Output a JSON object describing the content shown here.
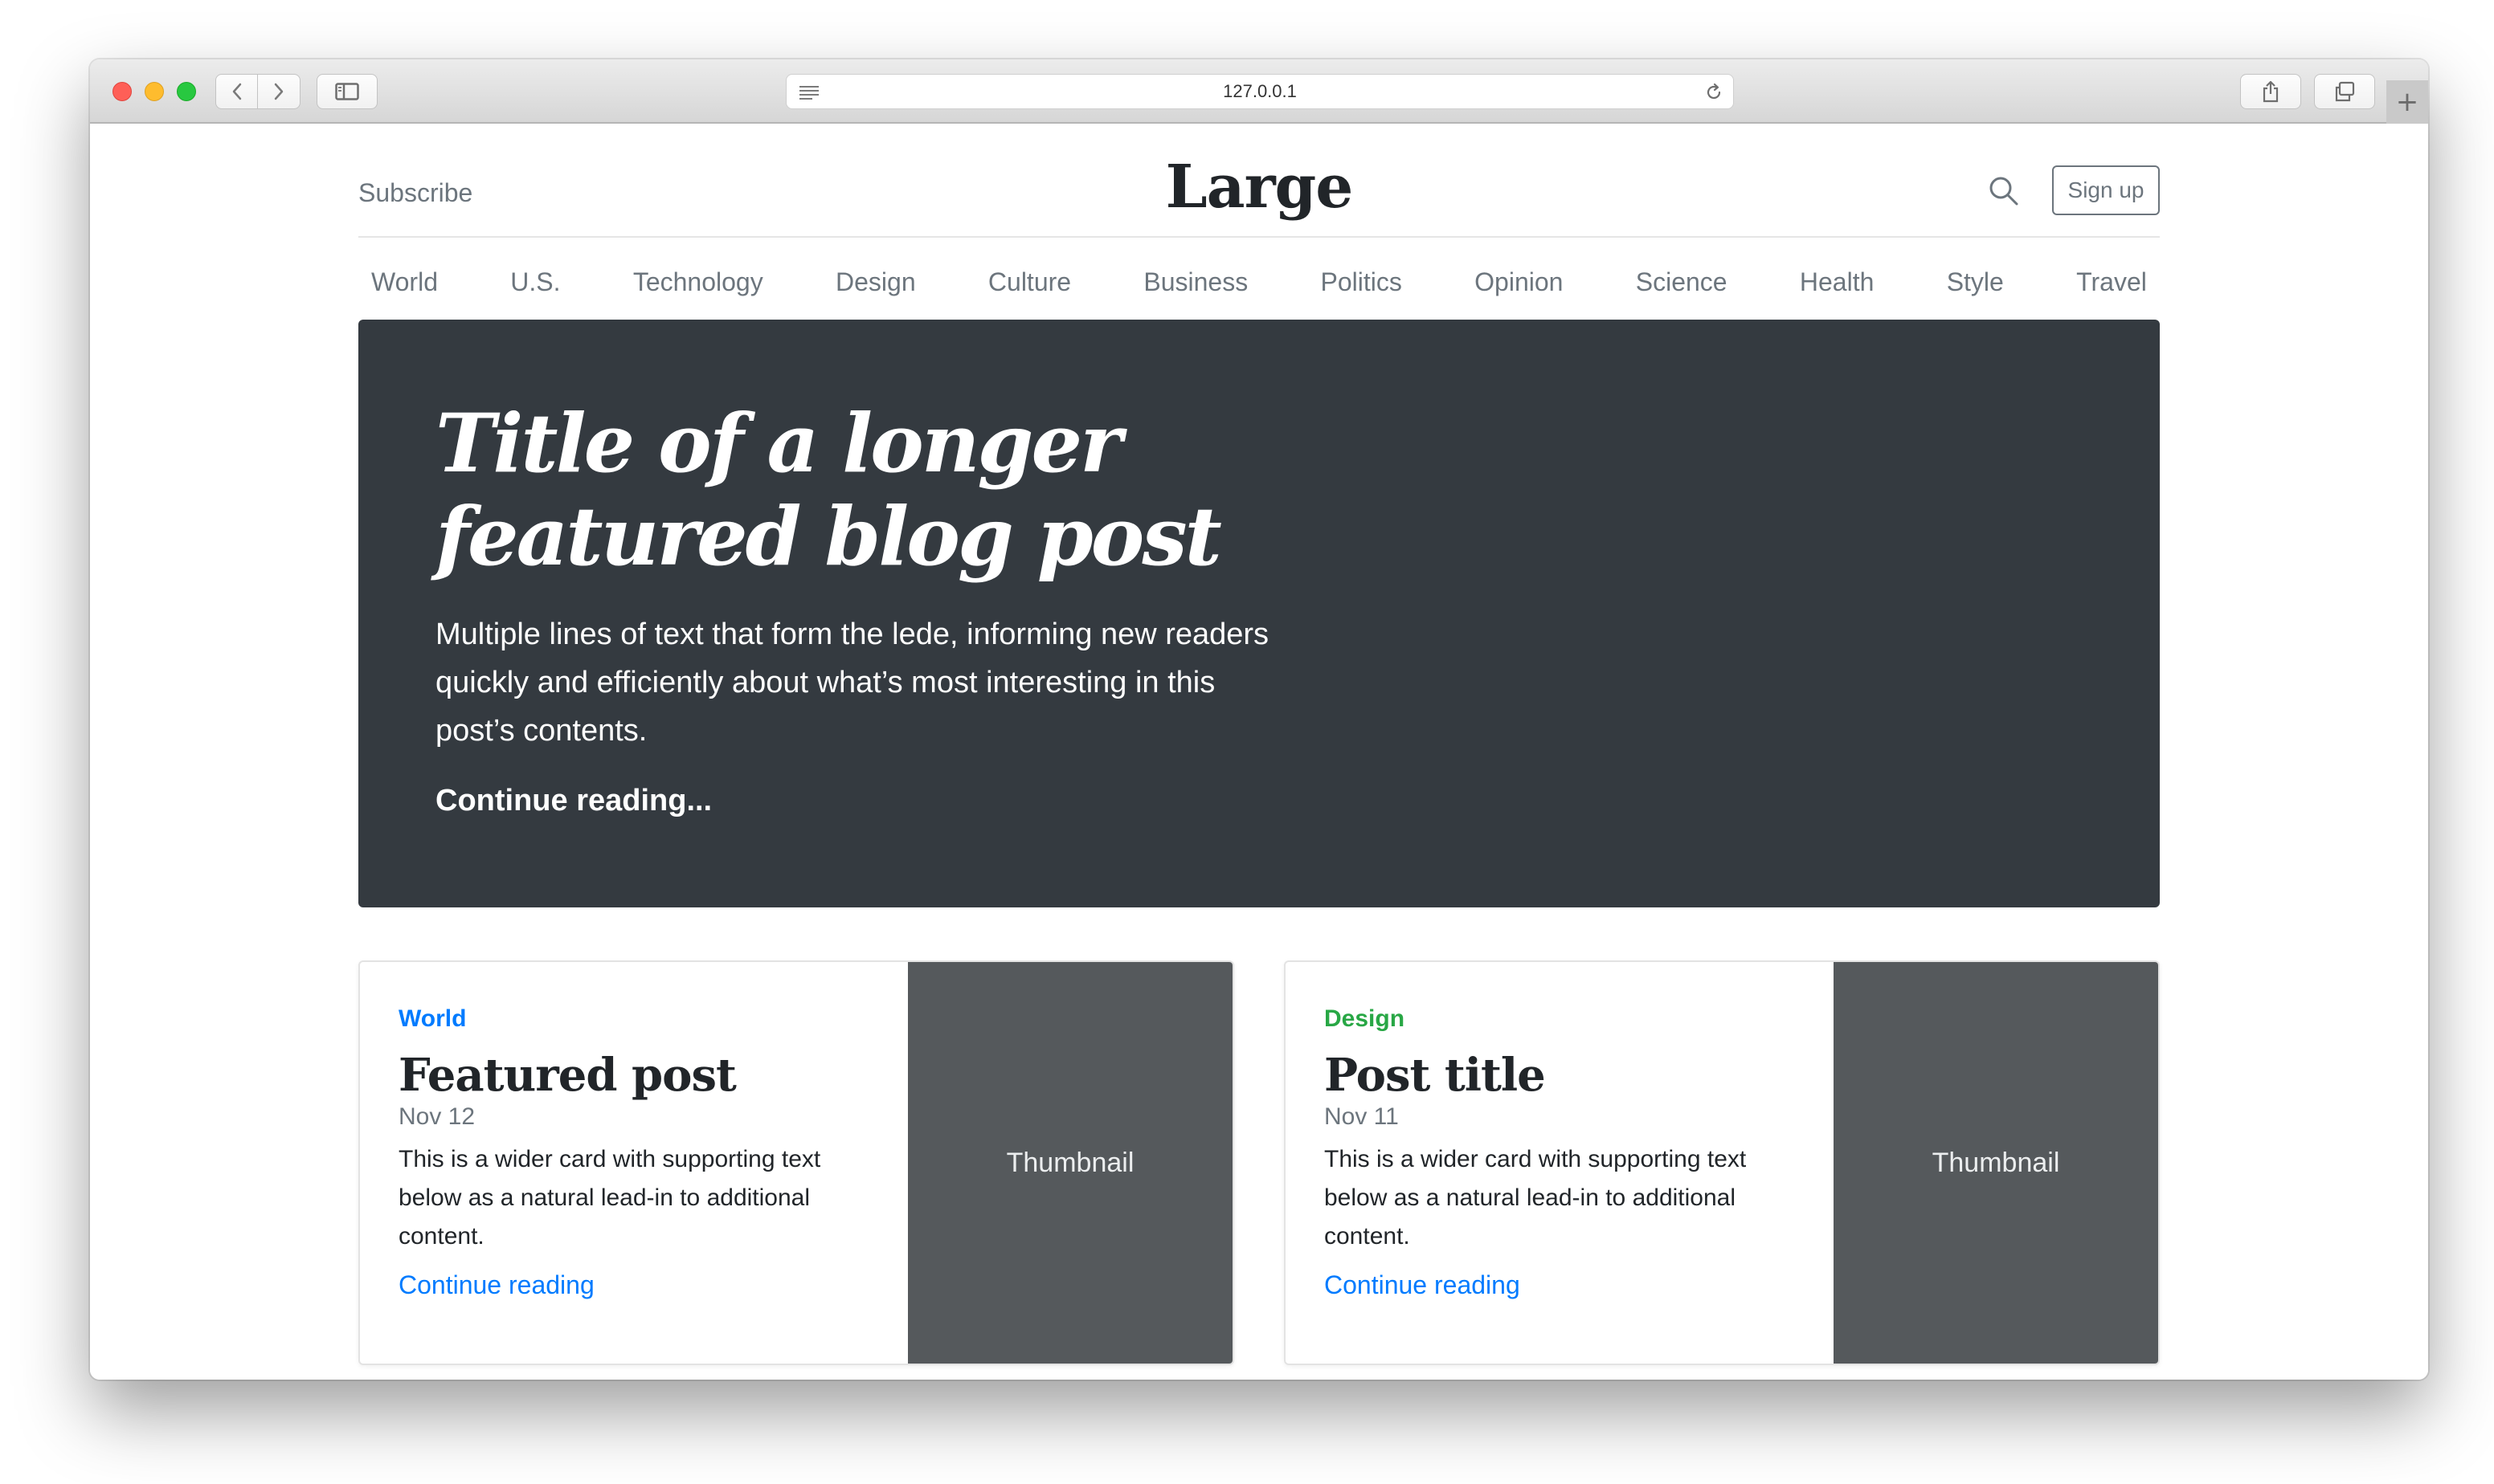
{
  "browser": {
    "url": "127.0.0.1"
  },
  "header": {
    "subscribe_label": "Subscribe",
    "logo": "Large",
    "signup_label": "Sign up"
  },
  "nav": {
    "items": [
      "World",
      "U.S.",
      "Technology",
      "Design",
      "Culture",
      "Business",
      "Politics",
      "Opinion",
      "Science",
      "Health",
      "Style",
      "Travel"
    ]
  },
  "hero": {
    "title_line1": "Title of a longer",
    "title_line2": "featured blog post",
    "lede": "Multiple lines of text that form the lede, informing new readers quickly and efficiently about what’s most interesting in this post’s contents.",
    "link_label": "Continue reading..."
  },
  "cards": [
    {
      "category": "World",
      "category_color": "#007bff",
      "title": "Featured post",
      "date": "Nov 12",
      "text": "This is a wider card with supporting text below as a natural lead-in to additional content.",
      "link_label": "Continue reading",
      "thumbnail_label": "Thumbnail"
    },
    {
      "category": "Design",
      "category_color": "#28a745",
      "title": "Post title",
      "date": "Nov 11",
      "text": "This is a wider card with supporting text below as a natural lead-in to additional content.",
      "link_label": "Continue reading",
      "thumbnail_label": "Thumbnail"
    }
  ],
  "icons": {
    "search": "search-icon",
    "back": "chevron-left-icon",
    "forward": "chevron-right-icon",
    "sidebar": "sidebar-icon",
    "share": "share-icon",
    "tabs": "tabs-icon",
    "reload": "reload-icon",
    "reader": "reader-icon",
    "new_tab": "plus-icon"
  }
}
